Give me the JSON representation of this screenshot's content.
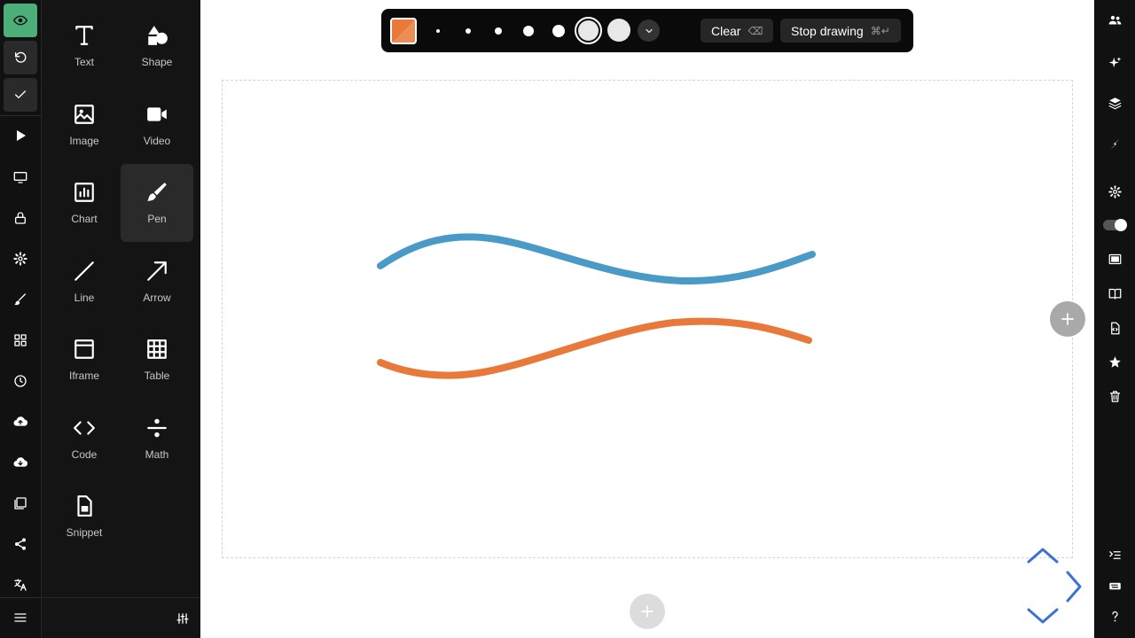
{
  "colors": {
    "pen_color": "#e8793a",
    "blue_stroke": "#4a9ac8",
    "orange_stroke": "#e8793a",
    "preview_active": "#4caf7a",
    "nav_arrows": "#3b73d1"
  },
  "left_rail": {
    "items": [
      {
        "name": "preview-eye-icon"
      },
      {
        "name": "undo-icon"
      },
      {
        "name": "check-icon"
      },
      {
        "name": "play-icon"
      },
      {
        "name": "present-icon"
      },
      {
        "name": "lock-icon"
      },
      {
        "name": "settings-icon"
      },
      {
        "name": "brush-icon"
      },
      {
        "name": "grid-icon"
      },
      {
        "name": "history-icon"
      },
      {
        "name": "upload-icon"
      },
      {
        "name": "download-icon"
      },
      {
        "name": "gallery-icon"
      },
      {
        "name": "share-icon"
      },
      {
        "name": "translate-icon"
      },
      {
        "name": "menu-icon"
      }
    ]
  },
  "insert_panel": {
    "tools": [
      {
        "label": "Text",
        "icon": "text-icon"
      },
      {
        "label": "Shape",
        "icon": "shape-icon"
      },
      {
        "label": "Image",
        "icon": "image-icon"
      },
      {
        "label": "Video",
        "icon": "video-icon"
      },
      {
        "label": "Chart",
        "icon": "chart-icon"
      },
      {
        "label": "Pen",
        "icon": "pen-icon",
        "active": true
      },
      {
        "label": "Line",
        "icon": "line-icon"
      },
      {
        "label": "Arrow",
        "icon": "arrow-icon"
      },
      {
        "label": "Iframe",
        "icon": "iframe-icon"
      },
      {
        "label": "Table",
        "icon": "table-icon"
      },
      {
        "label": "Code",
        "icon": "code-icon"
      },
      {
        "label": "Math",
        "icon": "math-icon"
      },
      {
        "label": "Snippet",
        "icon": "snippet-icon"
      }
    ],
    "footer_icon": "sliders-icon"
  },
  "draw_toolbar": {
    "brush_sizes": 7,
    "selected_size_index": 5,
    "clear_label": "Clear",
    "clear_shortcut": "⌫",
    "stop_label": "Stop drawing",
    "stop_shortcut": "⌘↵"
  },
  "right_rail": {
    "items": [
      {
        "name": "collaborators-icon"
      },
      {
        "name": "sparkle-icon"
      },
      {
        "name": "layers-icon"
      },
      {
        "name": "lightning-icon"
      },
      {
        "name": "settings-icon"
      },
      {
        "name": "toggle-switch"
      },
      {
        "name": "slide-icon"
      },
      {
        "name": "book-icon"
      },
      {
        "name": "code-file-icon"
      },
      {
        "name": "star-icon"
      },
      {
        "name": "trash-icon"
      },
      {
        "name": "outline-icon"
      },
      {
        "name": "keyboard-icon"
      },
      {
        "name": "help-icon"
      }
    ]
  }
}
